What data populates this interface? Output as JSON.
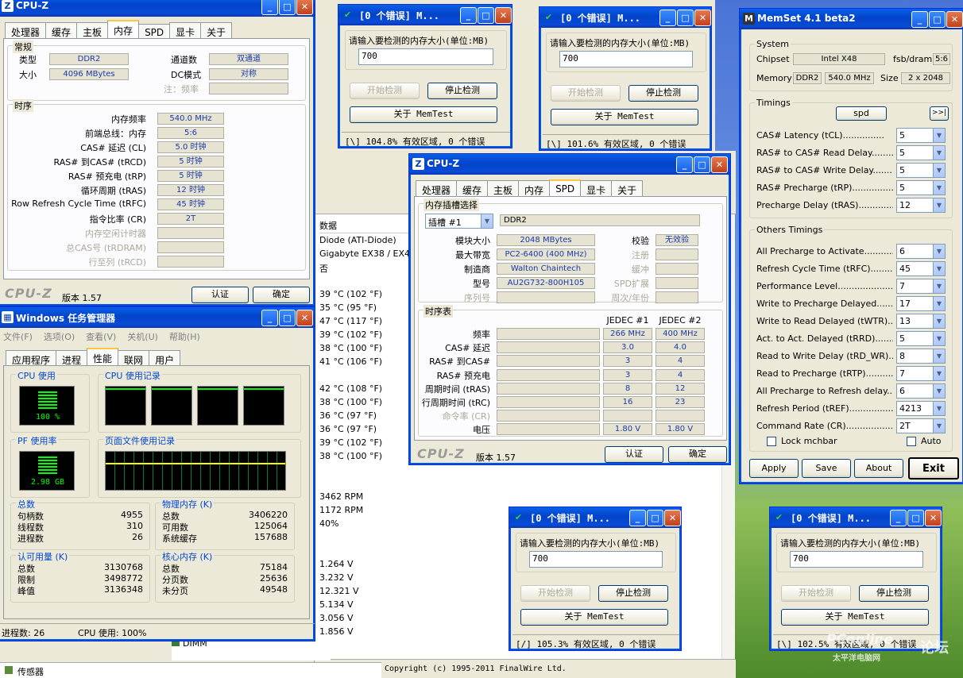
{
  "desktop": {
    "bg_top": "#5a7edc",
    "bg_bottom": "#6a9a3a"
  },
  "cpuz1": {
    "title": "CPU-Z",
    "tabs": [
      "处理器",
      "缓存",
      "主板",
      "内存",
      "SPD",
      "显卡",
      "关于"
    ],
    "active_tab": "内存",
    "general": {
      "label": "常规",
      "type_label": "类型",
      "type_val": "DDR2",
      "size_label": "大小",
      "size_val": "4096 MBytes",
      "channels_label": "通道数",
      "channels_val": "双通道",
      "dc_label": "DC模式",
      "dc_val": "对称",
      "nb_label": "注：频率"
    },
    "timing": {
      "label": "时序",
      "rows": [
        {
          "label": "内存频率",
          "value": "540.0 MHz"
        },
        {
          "label": "前端总线：内存",
          "value": "5:6"
        },
        {
          "label": "CAS# 延迟 (CL)",
          "value": "5.0 时钟"
        },
        {
          "label": "RAS# 到CAS# (tRCD)",
          "value": "5 时钟"
        },
        {
          "label": "RAS# 预充电 (tRP)",
          "value": "5 时钟"
        },
        {
          "label": "循环周期 (tRAS)",
          "value": "12 时钟"
        },
        {
          "label": "Row Refresh Cycle Time (tRFC)",
          "value": "45 时钟"
        },
        {
          "label": "指令比率 (CR)",
          "value": "2T"
        }
      ],
      "dim_rows": [
        "内存空闲计时器",
        "总CAS号 (tRDRAM)",
        "行至列 (tRCD)"
      ]
    },
    "footer": {
      "logo": "CPU-Z",
      "version": "版本 1.57",
      "validate": "认证",
      "ok": "确定"
    }
  },
  "memtest": {
    "title": "[0 个错误] M...",
    "prompt": "请输入要检测的内存大小(单位:MB)",
    "value": "700",
    "start": "开始检测",
    "stop": "停止检测",
    "about": "关于 MemTest",
    "statuses": [
      "[\\]  104.8% 有效区域, 0 个错误",
      "[\\]  101.6% 有效区域, 0 个错误",
      "[/]  105.3% 有效区域, 0 个错误",
      "[\\]  102.5% 有效区域, 0 个错误"
    ]
  },
  "memset": {
    "title": "MemSet 4.1 beta2",
    "system_label": "System",
    "chipset_label": "Chipset",
    "chipset": "Intel X48",
    "fsb_label": "fsb/dram",
    "fsb": "5:6",
    "memory_label": "Memory",
    "mem_type": "DDR2",
    "mem_freq": "540.0 MHz",
    "size_label": "Size",
    "size": "2 x 2048",
    "timings_label": "Timings",
    "spd_btn": "spd",
    "more_btn": ">>|",
    "timings": [
      {
        "label": "CAS# Latency (tCL)...............",
        "value": "5"
      },
      {
        "label": "RAS# to CAS# Read Delay..........",
        "value": "5"
      },
      {
        "label": "RAS# to CAS# Write Delay..........",
        "value": "5"
      },
      {
        "label": "RAS# Precharge (tRP)...............",
        "value": "5"
      },
      {
        "label": "Precharge Delay  (tRAS).............",
        "value": "12"
      }
    ],
    "others_label": "Others Timings",
    "others": [
      {
        "label": "All Precharge to Activate............",
        "value": "6"
      },
      {
        "label": "Refresh Cycle Time (tRFC)............",
        "value": "45"
      },
      {
        "label": "Performance Level......................",
        "value": "7"
      },
      {
        "label": "Write to Precharge Delayed..........",
        "value": "17"
      },
      {
        "label": "Write to Read Delayed (tWTR).........",
        "value": "13"
      },
      {
        "label": "Act. to Act. Delayed (tRRD)...........",
        "value": "5"
      },
      {
        "label": "Read to Write Delay (tRD_WR)........",
        "value": "8"
      },
      {
        "label": "Read to Precharge (tRTP)..............",
        "value": "7"
      },
      {
        "label": "All Precharge to Refresh delay.......",
        "value": "6"
      },
      {
        "label": "Refresh Period (tREF)..................",
        "value": "4213"
      },
      {
        "label": "Command Rate (CR)......................",
        "value": "2T"
      }
    ],
    "lock": "Lock mchbar",
    "auto": "Auto",
    "apply": "Apply",
    "save": "Save",
    "about": "About",
    "exit": "Exit"
  },
  "taskmgr": {
    "title": "Windows 任务管理器",
    "menu": [
      "文件(F)",
      "选项(O)",
      "查看(V)",
      "关机(U)",
      "帮助(H)"
    ],
    "tabs": [
      "应用程序",
      "进程",
      "性能",
      "联网",
      "用户"
    ],
    "active_tab": "性能",
    "cpu_usage_label": "CPU 使用",
    "cpu_usage": "100 %",
    "cpu_hist_label": "CPU 使用记录",
    "pf_label": "PF 使用率",
    "pf_value": "2.98 GB",
    "pf_hist_label": "页面文件使用记录",
    "totals": {
      "label": "总数",
      "rows": [
        [
          "句柄数",
          "4955"
        ],
        [
          "线程数",
          "310"
        ],
        [
          "进程数",
          "26"
        ]
      ]
    },
    "physical": {
      "label": "物理内存 (K)",
      "rows": [
        [
          "总数",
          "3406220"
        ],
        [
          "可用数",
          "125064"
        ],
        [
          "系统缓存",
          "157688"
        ]
      ]
    },
    "commit": {
      "label": "认可用量 (K)",
      "rows": [
        [
          "总数",
          "3130768"
        ],
        [
          "限制",
          "3498772"
        ],
        [
          "峰值",
          "3136348"
        ]
      ]
    },
    "kernel": {
      "label": "核心内存 (K)",
      "rows": [
        [
          "总数",
          "75184"
        ],
        [
          "分页数",
          "25636"
        ],
        [
          "未分页",
          "49548"
        ]
      ]
    },
    "status": {
      "procs": "进程数: 26",
      "cpu": "CPU 使用: 100%"
    }
  },
  "cpuz2": {
    "title": "CPU-Z",
    "tabs": [
      "处理器",
      "缓存",
      "主板",
      "内存",
      "SPD",
      "显卡",
      "关于"
    ],
    "active_tab": "SPD",
    "slot_label": "内存插槽选择",
    "slot": "插槽 #1",
    "slot_type": "DDR2",
    "left_rows": [
      [
        "模块大小",
        "2048 MBytes"
      ],
      [
        "最大带宽",
        "PC2-6400 (400 MHz)"
      ],
      [
        "制造商",
        "Walton Chaintech"
      ],
      [
        "型号",
        "AU2G732-800H105"
      ],
      [
        "序列号",
        ""
      ]
    ],
    "right_rows": [
      [
        "校验",
        "无效验"
      ],
      [
        "注册",
        ""
      ],
      [
        "缓冲",
        ""
      ],
      [
        "SPD扩展",
        ""
      ],
      [
        "周次/年份",
        ""
      ]
    ],
    "table_label": "时序表",
    "headers": [
      "",
      "",
      "JEDEC #1",
      "JEDEC #2"
    ],
    "table": [
      [
        "频率",
        "",
        "266 MHz",
        "400 MHz"
      ],
      [
        "CAS# 延迟",
        "",
        "3.0",
        "4.0"
      ],
      [
        "RAS# 到CAS#",
        "",
        "3",
        "4"
      ],
      [
        "RAS# 预充电",
        "",
        "3",
        "4"
      ],
      [
        "周期时间 (tRAS)",
        "",
        "8",
        "12"
      ],
      [
        "行周期时间 (tRC)",
        "",
        "16",
        "23"
      ],
      [
        "命令率 (CR)",
        "",
        "",
        ""
      ],
      [
        "电压",
        "",
        "1.80 V",
        "1.80 V"
      ]
    ],
    "footer": {
      "logo": "CPU-Z",
      "version": "版本 1.57",
      "validate": "认证",
      "ok": "确定"
    }
  },
  "everest": {
    "col_header": "数据",
    "values": [
      "Diode  (ATI-Diode)",
      "Gigabyte EX38 / EX48 /",
      "否",
      "",
      "39 °C  (102 °F)",
      "35 °C  (95 °F)",
      "47 °C  (117 °F)",
      "39 °C  (102 °F)",
      "38 °C  (100 °F)",
      "41 °C  (106 °F)",
      "",
      "42 °C  (108 °F)",
      "38 °C  (100 °F)",
      "36 °C  (97 °F)",
      "36 °C  (97 °F)",
      "39 °C  (102 °F)",
      "38 °C  (100 °F)",
      "",
      "",
      "3462 RPM",
      "1172 RPM",
      "40%",
      "",
      "",
      "1.264 V",
      "3.232 V",
      "12.321 V",
      "5.134 V",
      "3.056 V",
      "1.856 V"
    ],
    "dimm": "DIMM",
    "sensor": "传感器",
    "copyright": "Copyright (c) 1995-2011 FinalWire Ltd."
  },
  "watermark": {
    "brand": "PConline",
    "sub": "太平洋电脑网",
    "forum": "论坛"
  }
}
